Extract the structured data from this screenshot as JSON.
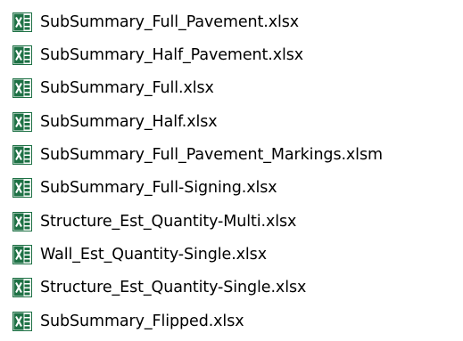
{
  "file_list": {
    "icon": "excel-file-icon",
    "accent_color": "#1e7145",
    "items": [
      {
        "name": "SubSummary_Full_Pavement.xlsx"
      },
      {
        "name": "SubSummary_Half_Pavement.xlsx"
      },
      {
        "name": "SubSummary_Full.xlsx"
      },
      {
        "name": "SubSummary_Half.xlsx"
      },
      {
        "name": "SubSummary_Full_Pavement_Markings.xlsm"
      },
      {
        "name": "SubSummary_Full-Signing.xlsx"
      },
      {
        "name": "Structure_Est_Quantity-Multi.xlsx"
      },
      {
        "name": "Wall_Est_Quantity-Single.xlsx"
      },
      {
        "name": "Structure_Est_Quantity-Single.xlsx"
      },
      {
        "name": "SubSummary_Flipped.xlsx"
      }
    ]
  }
}
